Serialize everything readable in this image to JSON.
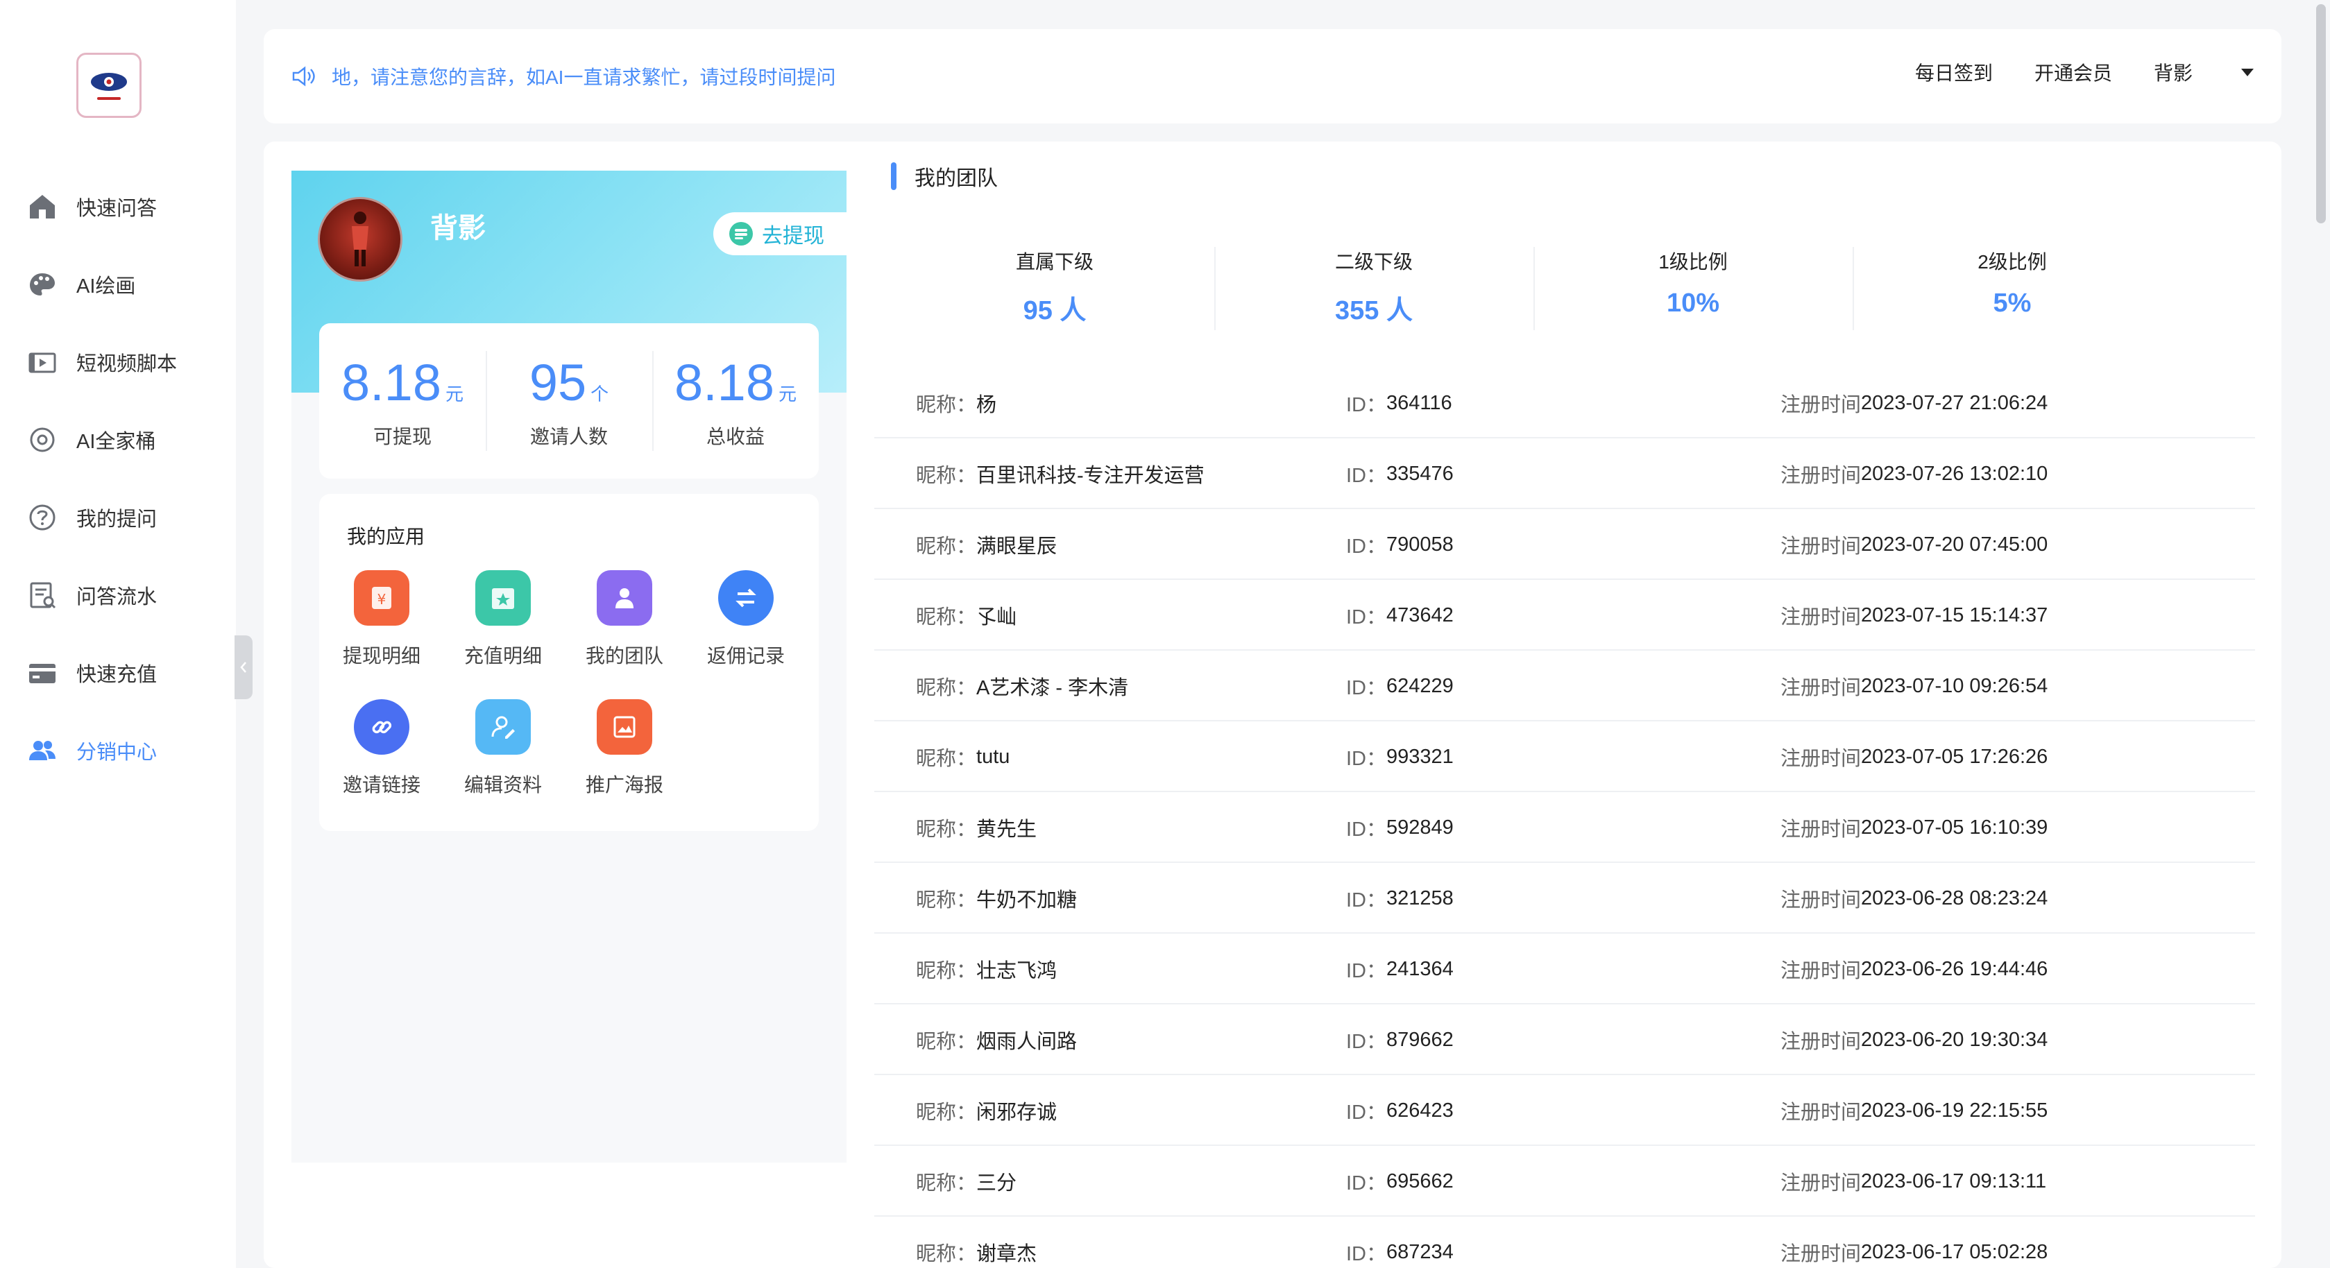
{
  "sidebar": {
    "items": [
      {
        "label": "快速问答",
        "icon": "home-icon"
      },
      {
        "label": "AI绘画",
        "icon": "palette-icon"
      },
      {
        "label": "短视频脚本",
        "icon": "video-icon"
      },
      {
        "label": "AI全家桶",
        "icon": "bucket-icon"
      },
      {
        "label": "我的提问",
        "icon": "question-icon"
      },
      {
        "label": "问答流水",
        "icon": "history-icon"
      },
      {
        "label": "快速充值",
        "icon": "card-icon"
      },
      {
        "label": "分销中心",
        "icon": "users-icon"
      }
    ],
    "active_index": 7
  },
  "topbar": {
    "notice": "地，请注意您的言辞，如AI一直请求繁忙，请过段时间提问",
    "checkin": "每日签到",
    "membership": "开通会员",
    "user_menu": "背影"
  },
  "profile": {
    "name": "背影",
    "withdraw_button": "去提现",
    "stats": [
      {
        "value": "8.18",
        "unit": "元",
        "label": "可提现"
      },
      {
        "value": "95",
        "unit": "个",
        "label": "邀请人数"
      },
      {
        "value": "8.18",
        "unit": "元",
        "label": "总收益"
      }
    ]
  },
  "apps": {
    "title": "我的应用",
    "items": [
      {
        "label": "提现明细",
        "icon": "yuan-icon",
        "color": "#f3643c"
      },
      {
        "label": "充值明细",
        "icon": "calendar-star-icon",
        "color": "#3cc7a8"
      },
      {
        "label": "我的团队",
        "icon": "team-icon",
        "color": "#8b6cf0"
      },
      {
        "label": "返佣记录",
        "icon": "exchange-icon",
        "color": "#3f83f6"
      },
      {
        "label": "邀请链接",
        "icon": "link-icon",
        "color": "#4a6ff2"
      },
      {
        "label": "编辑资料",
        "icon": "edit-profile-icon",
        "color": "#55b8f5"
      },
      {
        "label": "推广海报",
        "icon": "poster-icon",
        "color": "#f3643c"
      }
    ]
  },
  "team": {
    "title": "我的团队",
    "stats": [
      {
        "label": "直属下级",
        "value": "95 人"
      },
      {
        "label": "二级下级",
        "value": "355 人"
      },
      {
        "label": "1级比例",
        "value": "10%"
      },
      {
        "label": "2级比例",
        "value": "5%"
      }
    ],
    "labels": {
      "nickname": "昵称：",
      "id": "ID：",
      "reg": "注册时间"
    },
    "members": [
      {
        "nickname": "杨",
        "id": "364116",
        "reg": "2023-07-27 21:06:24"
      },
      {
        "nickname": "百里讯科技-专注开发运营",
        "id": "335476",
        "reg": "2023-07-26 13:02:10"
      },
      {
        "nickname": "满眼星辰",
        "id": "790058",
        "reg": "2023-07-20 07:45:00"
      },
      {
        "nickname": "孓屾",
        "id": "473642",
        "reg": "2023-07-15 15:14:37"
      },
      {
        "nickname": "A艺术漆 - 李木清",
        "id": "624229",
        "reg": "2023-07-10 09:26:54"
      },
      {
        "nickname": "tutu",
        "id": "993321",
        "reg": "2023-07-05 17:26:26"
      },
      {
        "nickname": "黄先生",
        "id": "592849",
        "reg": "2023-07-05 16:10:39"
      },
      {
        "nickname": "牛奶不加糖",
        "id": "321258",
        "reg": "2023-06-28 08:23:24"
      },
      {
        "nickname": "壮志飞鸿",
        "id": "241364",
        "reg": "2023-06-26 19:44:46"
      },
      {
        "nickname": "烟雨人间路",
        "id": "879662",
        "reg": "2023-06-20 19:30:34"
      },
      {
        "nickname": "闲邪存诚",
        "id": "626423",
        "reg": "2023-06-19 22:15:55"
      },
      {
        "nickname": "三分",
        "id": "695662",
        "reg": "2023-06-17 09:13:11"
      },
      {
        "nickname": "谢章杰",
        "id": "687234",
        "reg": "2023-06-17 05:02:28"
      }
    ]
  },
  "colors": {
    "accent": "#4a8df8",
    "profile_gradient": "#5fd3ee"
  }
}
